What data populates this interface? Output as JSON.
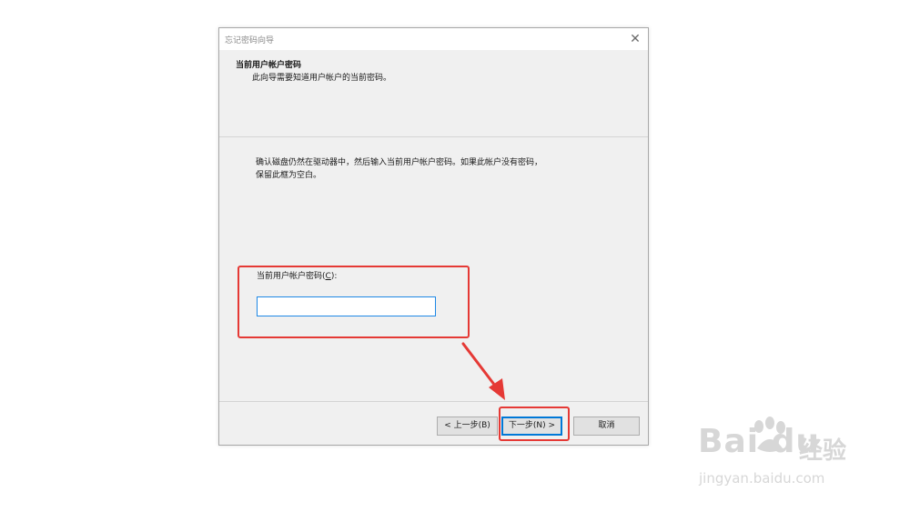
{
  "window": {
    "title": "忘记密码向导",
    "close_glyph": "✕"
  },
  "header": {
    "title": "当前用户帐户密码",
    "subtitle": "此向导需要知道用户帐户的当前密码。"
  },
  "body": {
    "description_line1": "确认磁盘仍然在驱动器中，然后输入当前用户帐户密码。如果此帐户没有密码，",
    "description_line2": "保留此框为空白。",
    "password_label_prefix": "当前用户帐户密码(",
    "password_label_accel": "C",
    "password_label_suffix": "):",
    "password_value": ""
  },
  "buttons": {
    "back": "< 上一步(B)",
    "next": "下一步(N) >",
    "cancel": "取消"
  },
  "annotation": {
    "highlight_color": "#e53935"
  },
  "watermark": {
    "logo": "Bai  du",
    "brand": "经验",
    "url": "jingyan.baidu.com"
  },
  "colors": {
    "focus_blue": "#1e88e5",
    "dialog_bg": "#f0f0f0"
  }
}
